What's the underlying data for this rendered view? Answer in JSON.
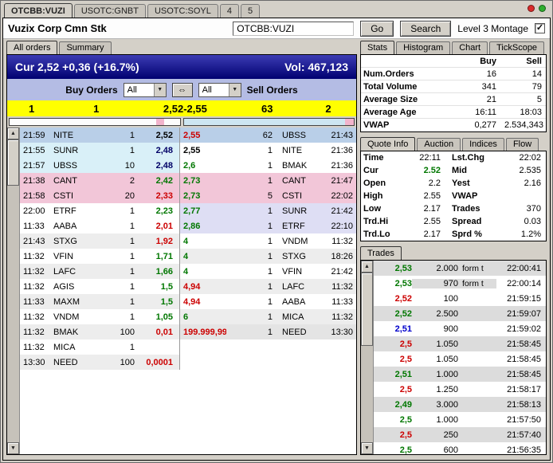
{
  "window": {
    "tabs": [
      {
        "label": "OTCBB:VUZI",
        "active": true
      },
      {
        "label": "USOTC:GNBT",
        "active": false
      },
      {
        "label": "USOTC:SOYL",
        "active": false
      },
      {
        "label": "4",
        "active": false
      },
      {
        "label": "5",
        "active": false
      }
    ],
    "indicators": [
      {
        "name": "red",
        "color": "#d92b2b"
      },
      {
        "name": "green",
        "color": "#2fae2f"
      }
    ]
  },
  "header": {
    "title": "Vuzix Corp Cmn Stk",
    "symbol_value": "OTCBB:VUZI",
    "go_label": "Go",
    "search_label": "Search",
    "level3_label": "Level 3 Montage",
    "level3_checked": "✓"
  },
  "montage": {
    "tabs": [
      {
        "label": "All orders",
        "active": true
      },
      {
        "label": "Summary",
        "active": false
      }
    ],
    "cur_text": "Cur 2,52 +0,36 (+16.7%)",
    "vol_text": "Vol: 467,123",
    "buy_orders_label": "Buy Orders",
    "sell_orders_label": "Sell Orders",
    "buy_filter_value": "All",
    "sell_filter_value": "All",
    "link_icon": "⇔",
    "summary": {
      "buy_orders": "1",
      "buy_size": "1",
      "price_range": "2,52-2,55",
      "sell_size": "63",
      "sell_orders": "2"
    },
    "depth_buy": [
      {
        "color": "#fdfdfd",
        "pct": 86
      },
      {
        "color": "#f2b4cc",
        "pct": 5
      },
      {
        "color": "#fdfdfd",
        "pct": 9
      }
    ],
    "depth_sell": [
      {
        "color": "#cde6f2",
        "pct": 95
      },
      {
        "color": "#f2b4cc",
        "pct": 5
      }
    ],
    "rows": [
      {
        "buy": {
          "time": "21:59",
          "mmid": "NITE",
          "size": "1",
          "price": "2,52",
          "price_color": "#000000",
          "bg": "#b9cfe8"
        },
        "sell": {
          "price": "2,55",
          "size": "62",
          "mmid": "UBSS",
          "time": "21:43",
          "price_color": "#cc0000",
          "bg": "#b9cfe8"
        }
      },
      {
        "buy": {
          "time": "21:55",
          "mmid": "SUNR",
          "size": "1",
          "price": "2,48",
          "price_color": "#000066",
          "bg": "#d9f0f8"
        },
        "sell": {
          "price": "2,55",
          "size": "1",
          "mmid": "NITE",
          "time": "21:36",
          "price_color": "#000000",
          "bg": "#ffffff"
        }
      },
      {
        "buy": {
          "time": "21:57",
          "mmid": "UBSS",
          "size": "10",
          "price": "2,48",
          "price_color": "#000066",
          "bg": "#d9f0f8"
        },
        "sell": {
          "price": "2,6",
          "size": "1",
          "mmid": "BMAK",
          "time": "21:36",
          "price_color": "#007700",
          "bg": "#ffffff"
        }
      },
      {
        "buy": {
          "time": "21:38",
          "mmid": "CANT",
          "size": "2",
          "price": "2,42",
          "price_color": "#007700",
          "bg": "#f2c6d8"
        },
        "sell": {
          "price": "2,73",
          "size": "1",
          "mmid": "CANT",
          "time": "21:47",
          "price_color": "#007700",
          "bg": "#f2c6d8"
        }
      },
      {
        "buy": {
          "time": "21:58",
          "mmid": "CSTI",
          "size": "20",
          "price": "2,33",
          "price_color": "#cc0000",
          "bg": "#f2c6d8"
        },
        "sell": {
          "price": "2,73",
          "size": "5",
          "mmid": "CSTI",
          "time": "22:02",
          "price_color": "#007700",
          "bg": "#f2c6d8"
        }
      },
      {
        "buy": {
          "time": "22:00",
          "mmid": "ETRF",
          "size": "1",
          "price": "2,23",
          "price_color": "#007700",
          "bg": "#ffffff"
        },
        "sell": {
          "price": "2,77",
          "size": "1",
          "mmid": "SUNR",
          "time": "21:42",
          "price_color": "#007700",
          "bg": "#dedef4"
        }
      },
      {
        "buy": {
          "time": "11:33",
          "mmid": "AABA",
          "size": "1",
          "price": "2,01",
          "price_color": "#cc0000",
          "bg": "#ffffff"
        },
        "sell": {
          "price": "2,86",
          "size": "1",
          "mmid": "ETRF",
          "time": "22:10",
          "price_color": "#007700",
          "bg": "#dedef4"
        }
      },
      {
        "buy": {
          "time": "21:43",
          "mmid": "STXG",
          "size": "1",
          "price": "1,92",
          "price_color": "#cc0000",
          "bg": "#ededed"
        },
        "sell": {
          "price": "4",
          "size": "1",
          "mmid": "VNDM",
          "time": "11:32",
          "price_color": "#007700",
          "bg": "#ffffff"
        }
      },
      {
        "buy": {
          "time": "11:32",
          "mmid": "VFIN",
          "size": "1",
          "price": "1,71",
          "price_color": "#007700",
          "bg": "#ffffff"
        },
        "sell": {
          "price": "4",
          "size": "1",
          "mmid": "STXG",
          "time": "18:26",
          "price_color": "#007700",
          "bg": "#ededed"
        }
      },
      {
        "buy": {
          "time": "11:32",
          "mmid": "LAFC",
          "size": "1",
          "price": "1,66",
          "price_color": "#007700",
          "bg": "#ededed"
        },
        "sell": {
          "price": "4",
          "size": "1",
          "mmid": "VFIN",
          "time": "21:42",
          "price_color": "#007700",
          "bg": "#ffffff"
        }
      },
      {
        "buy": {
          "time": "11:32",
          "mmid": "AGIS",
          "size": "1",
          "price": "1,5",
          "price_color": "#007700",
          "bg": "#ffffff"
        },
        "sell": {
          "price": "4,94",
          "size": "1",
          "mmid": "LAFC",
          "time": "11:32",
          "price_color": "#cc0000",
          "bg": "#ededed"
        }
      },
      {
        "buy": {
          "time": "11:33",
          "mmid": "MAXM",
          "size": "1",
          "price": "1,5",
          "price_color": "#007700",
          "bg": "#ededed"
        },
        "sell": {
          "price": "4,94",
          "size": "1",
          "mmid": "AABA",
          "time": "11:33",
          "price_color": "#cc0000",
          "bg": "#ffffff"
        }
      },
      {
        "buy": {
          "time": "11:32",
          "mmid": "VNDM",
          "size": "1",
          "price": "1,05",
          "price_color": "#007700",
          "bg": "#ffffff"
        },
        "sell": {
          "price": "6",
          "size": "1",
          "mmid": "MICA",
          "time": "11:32",
          "price_color": "#007700",
          "bg": "#ededed"
        }
      },
      {
        "buy": {
          "time": "11:32",
          "mmid": "BMAK",
          "size": "100",
          "price": "0,01",
          "price_color": "#cc0000",
          "bg": "#ededed"
        },
        "sell": {
          "price": "199.999,99",
          "size": "1",
          "mmid": "NEED",
          "time": "13:30",
          "price_color": "#cc0000",
          "bg": "#e4e4e4"
        }
      },
      {
        "buy": {
          "time": "11:32",
          "mmid": "MICA",
          "size": "1",
          "price": "",
          "price_color": "#000000",
          "bg": "#ffffff"
        },
        "sell": {
          "price": "",
          "size": "",
          "mmid": "",
          "time": "",
          "price_color": "#000000",
          "bg": "#ffffff"
        }
      },
      {
        "buy": {
          "time": "13:30",
          "mmid": "NEED",
          "size": "100",
          "price": "0,0001",
          "price_color": "#cc0000",
          "bg": "#ededed"
        },
        "sell": {
          "price": "",
          "size": "",
          "mmid": "",
          "time": "",
          "price_color": "#000000",
          "bg": "#ffffff"
        }
      }
    ]
  },
  "stats": {
    "tabs": [
      {
        "label": "Stats",
        "active": true
      },
      {
        "label": "Histogram",
        "active": false
      },
      {
        "label": "Chart",
        "active": false
      },
      {
        "label": "TickScope",
        "active": false
      }
    ],
    "col_buy": "Buy",
    "col_sell": "Sell",
    "rows": [
      {
        "label": "Num.Orders",
        "buy": "16",
        "sell": "14"
      },
      {
        "label": "Total Volume",
        "buy": "341",
        "sell": "79"
      },
      {
        "label": "Average Size",
        "buy": "21",
        "sell": "5"
      },
      {
        "label": "Average Age",
        "buy": "16:11",
        "sell": "18:03"
      },
      {
        "label": "VWAP",
        "buy": "0,277",
        "sell": "2.534,343"
      }
    ]
  },
  "quote": {
    "tabs": [
      {
        "label": "Quote Info",
        "active": true
      },
      {
        "label": "Auction",
        "active": false
      },
      {
        "label": "Indices",
        "active": false
      },
      {
        "label": "Flow",
        "active": false
      }
    ],
    "rows": [
      {
        "l1": "Time",
        "v1": "22:11",
        "l2": "Lst.Chg",
        "v2": "22:02"
      },
      {
        "l1": "Cur",
        "v1": "2.52",
        "v1_color": "#007700",
        "l2": "Mid",
        "v2": "2.535"
      },
      {
        "l1": "Open",
        "v1": "2.2",
        "l2": "Yest",
        "v2": "2.16"
      },
      {
        "l1": "High",
        "v1": "2.55",
        "l2": "VWAP",
        "v2": ""
      },
      {
        "l1": "Low",
        "v1": "2.17",
        "l2": "Trades",
        "v2": "370"
      },
      {
        "l1": "Trd.Hi",
        "v1": "2.55",
        "l2": "Spread",
        "v2": "0.03"
      },
      {
        "l1": "Trd.Lo",
        "v1": "2.17",
        "l2": "Sprd %",
        "v2": "1.2%"
      }
    ]
  },
  "trades": {
    "tab_label": "Trades",
    "rows": [
      {
        "price": "2,53",
        "price_color": "#007700",
        "qty": "2.000",
        "flag": "form t",
        "time": "22:00:41",
        "bg": "#dcdcdc",
        "mid_bg": ""
      },
      {
        "price": "2,53",
        "price_color": "#007700",
        "qty": "970",
        "flag": "form t",
        "time": "22:00:14",
        "bg": "#ffffff",
        "mid_bg": "#dcdcdc"
      },
      {
        "price": "2,52",
        "price_color": "#cc0000",
        "qty": "100",
        "flag": "",
        "time": "21:59:15",
        "bg": "#ffffff",
        "mid_bg": ""
      },
      {
        "price": "2,52",
        "price_color": "#007700",
        "qty": "2.500",
        "flag": "",
        "time": "21:59:07",
        "bg": "#dcdcdc",
        "mid_bg": ""
      },
      {
        "price": "2,51",
        "price_color": "#0000cc",
        "qty": "900",
        "flag": "",
        "time": "21:59:02",
        "bg": "#ffffff",
        "mid_bg": ""
      },
      {
        "price": "2,5",
        "price_color": "#cc0000",
        "qty": "1.050",
        "flag": "",
        "time": "21:58:45",
        "bg": "#dcdcdc",
        "mid_bg": ""
      },
      {
        "price": "2,5",
        "price_color": "#cc0000",
        "qty": "1.050",
        "flag": "",
        "time": "21:58:45",
        "bg": "#ffffff",
        "mid_bg": ""
      },
      {
        "price": "2,51",
        "price_color": "#007700",
        "qty": "1.000",
        "flag": "",
        "time": "21:58:45",
        "bg": "#dcdcdc",
        "mid_bg": ""
      },
      {
        "price": "2,5",
        "price_color": "#cc0000",
        "qty": "1.250",
        "flag": "",
        "time": "21:58:17",
        "bg": "#ffffff",
        "mid_bg": ""
      },
      {
        "price": "2,49",
        "price_color": "#007700",
        "qty": "3.000",
        "flag": "",
        "time": "21:58:13",
        "bg": "#dcdcdc",
        "mid_bg": ""
      },
      {
        "price": "2,5",
        "price_color": "#007700",
        "qty": "1.000",
        "flag": "",
        "time": "21:57:50",
        "bg": "#ffffff",
        "mid_bg": ""
      },
      {
        "price": "2,5",
        "price_color": "#cc0000",
        "qty": "250",
        "flag": "",
        "time": "21:57:40",
        "bg": "#dcdcdc",
        "mid_bg": ""
      },
      {
        "price": "2,5",
        "price_color": "#007700",
        "qty": "600",
        "flag": "",
        "time": "21:56:35",
        "bg": "#ffffff",
        "mid_bg": ""
      }
    ]
  }
}
